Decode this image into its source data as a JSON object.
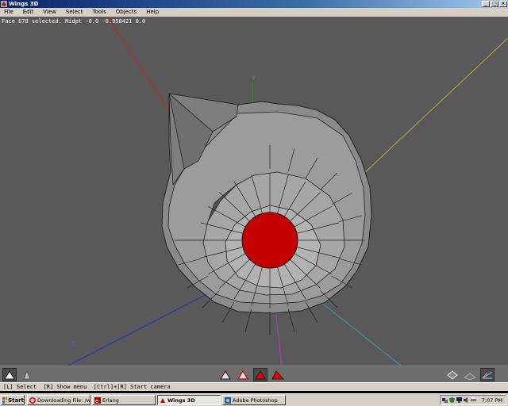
{
  "window": {
    "title": "Wings 3D"
  },
  "menu": [
    "File",
    "Edit",
    "View",
    "Select",
    "Tools",
    "Objects",
    "Help"
  ],
  "viewport": {
    "info": "Face 878 selected. Midpt -0.0 -0.958421 0.0",
    "axis_y_label": "Y",
    "axis_z_label": "Z",
    "background": "#595959",
    "face_color": "#9a9a9a",
    "selected_face_color": "#c40000",
    "axis_colors": {
      "x": "#d02020",
      "y": "#b0b030",
      "z": "#3030c0",
      "neg_y": "#c030c0",
      "neg_x": "#30a0a0"
    }
  },
  "toolbar": {
    "buttons": [
      "smooth-shade",
      "flat-shade",
      "vertex-mode",
      "edge-mode",
      "face-mode",
      "body-mode",
      "ortho-view",
      "toggle-ground",
      "toggle-axes"
    ]
  },
  "status": {
    "text": "[L] Select  [R] Show menu  [Ctrl]+[R] Start camera"
  },
  "taskbar": {
    "start": "Start",
    "tasks": [
      {
        "label": "Downloading File: /wings/...",
        "icon": "opera-icon"
      },
      {
        "label": "Erlang",
        "icon": "erlang-icon"
      },
      {
        "label": "Wings 3D",
        "icon": "wings-icon"
      },
      {
        "label": "Adobe Photoshop",
        "icon": "photoshop-icon"
      }
    ],
    "clock": "7:07 PM"
  }
}
